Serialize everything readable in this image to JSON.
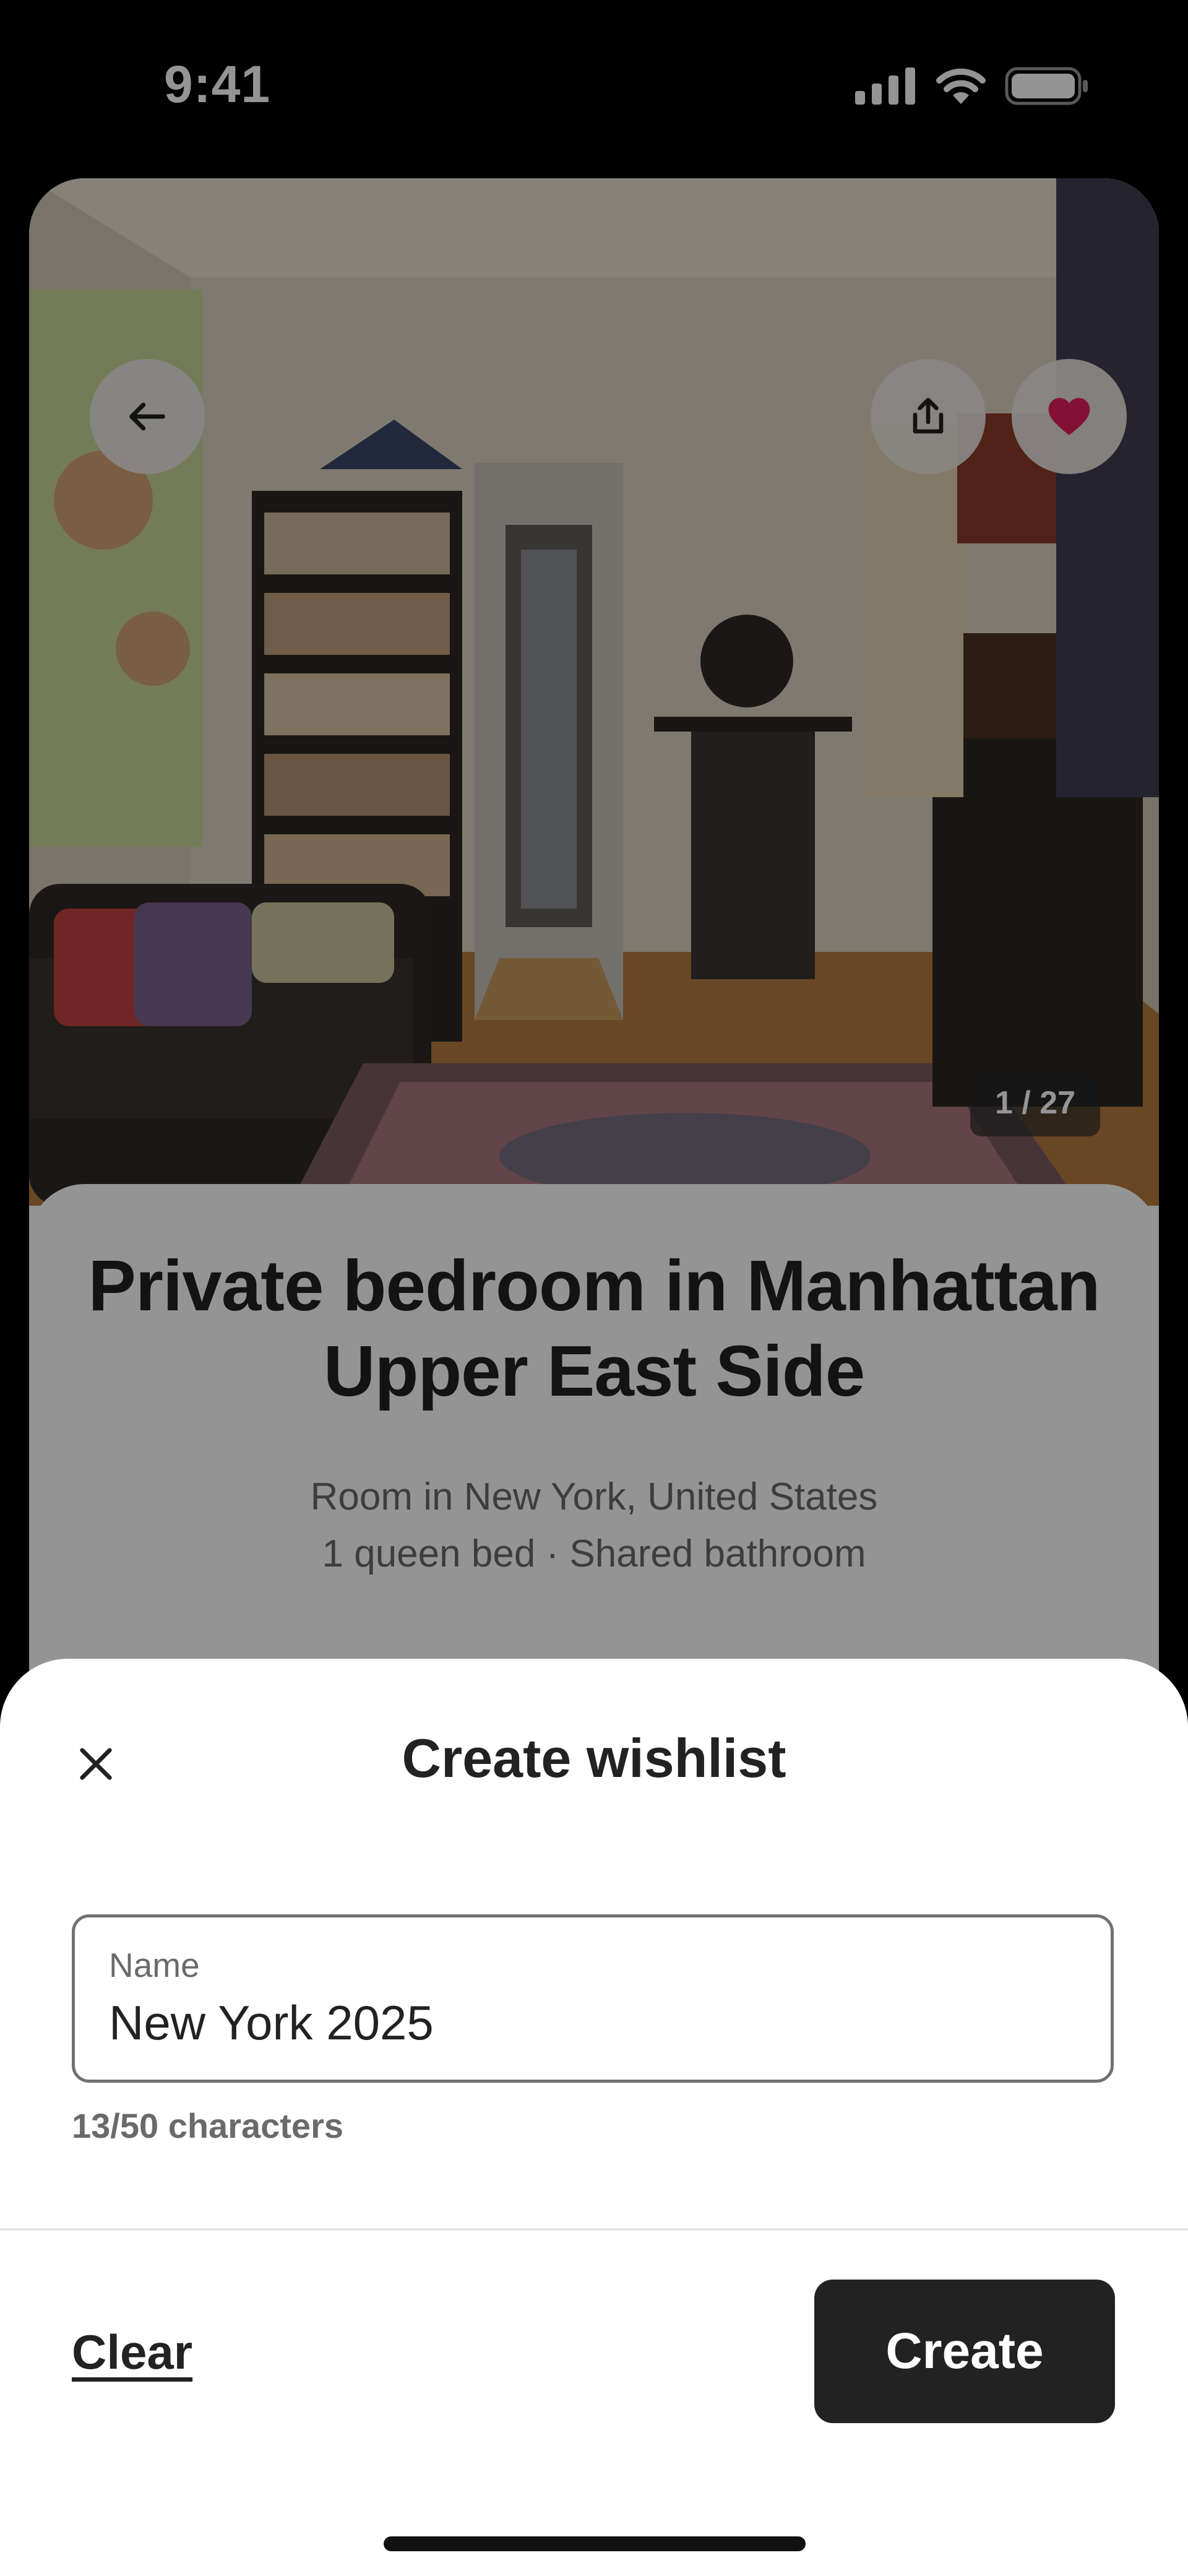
{
  "status_bar": {
    "time": "9:41"
  },
  "photo": {
    "counter": "1 / 27"
  },
  "actions": {
    "back_icon": "arrow-left-icon",
    "share_icon": "share-icon",
    "saved_icon": "heart-icon",
    "saved_color": "#E31C5F"
  },
  "listing": {
    "title": "Private bedroom in Manhattan Upper East Side",
    "location": "Room in New York, United States",
    "details": "1 queen bed · Shared bathroom"
  },
  "sheet": {
    "title": "Create wishlist",
    "close_icon": "close-icon",
    "name_field": {
      "label": "Name",
      "value": "New York 2025"
    },
    "char_count": "13/50 characters",
    "clear_label": "Clear",
    "create_label": "Create"
  }
}
